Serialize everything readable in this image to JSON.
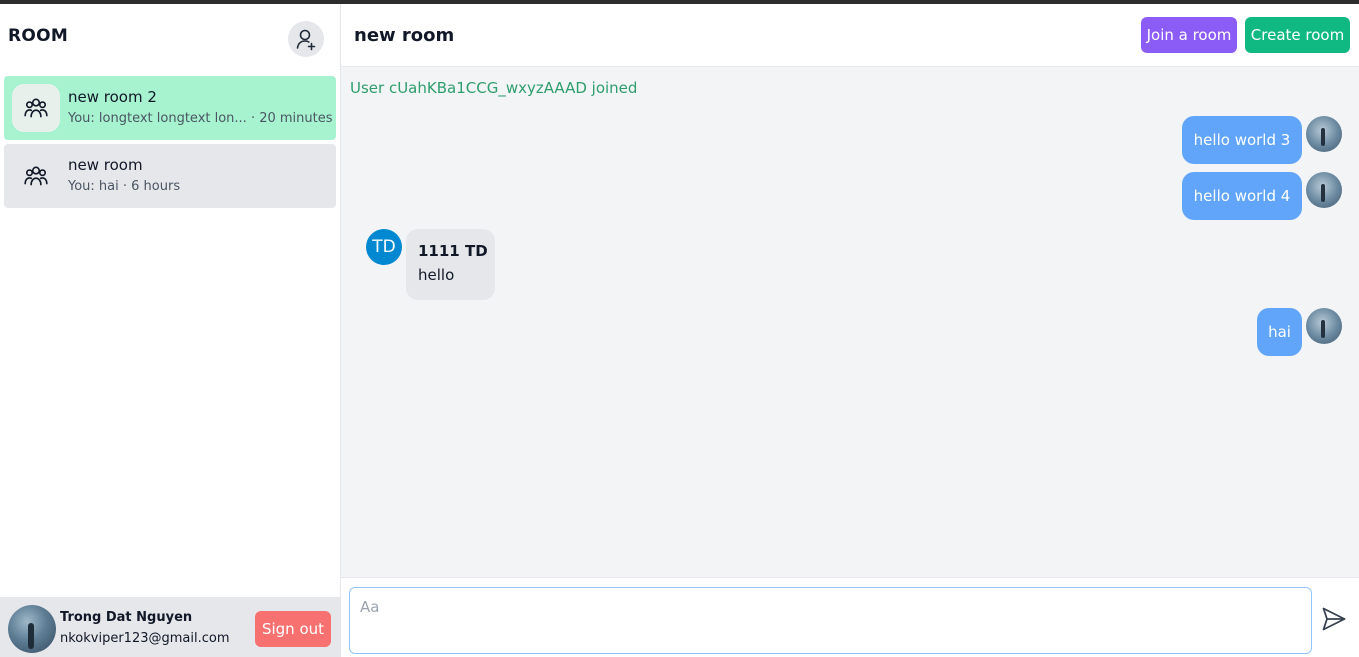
{
  "sidebar": {
    "title": "ROOM",
    "add_room_icon": "user-plus-icon",
    "rooms": [
      {
        "name": "new room 2",
        "preview": "You: longtext longtext lon... · 20 minutes",
        "icon": "group-icon",
        "active": true
      },
      {
        "name": "new room",
        "preview": "You: hai · 6 hours",
        "icon": "group-icon",
        "active": false
      }
    ],
    "user": {
      "name": "Trong Dat Nguyen",
      "email": "nkokviper123@gmail.com",
      "signout_label": "Sign out"
    }
  },
  "header": {
    "room_title": "new room",
    "join_label": "Join a room",
    "create_label": "Create room"
  },
  "messages": {
    "system": "User cUahKBa1CCG_wxyzAAAD joined",
    "items": [
      {
        "mine": true,
        "text": "hello world 3"
      },
      {
        "mine": true,
        "text": "hello world 4"
      },
      {
        "mine": false,
        "sender": "1111 TD",
        "initials": "TD",
        "text": "hello"
      },
      {
        "mine": true,
        "text": "hai"
      }
    ]
  },
  "composer": {
    "placeholder": "Aa",
    "send_icon": "send-icon"
  },
  "colors": {
    "active_room": "#a7f3d0",
    "inactive_room": "#e5e7eb",
    "join_button": "#8b5cf6",
    "create_button": "#10b981",
    "signout_button": "#f87171",
    "my_bubble": "#60a5fa",
    "system_text": "#2e9e6e"
  }
}
